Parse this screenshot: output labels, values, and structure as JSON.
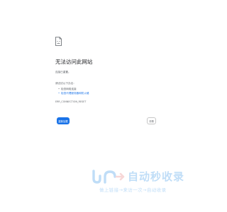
{
  "error_page": {
    "icon": "sad-document-icon",
    "title": "无法访问此网站",
    "subtitle": "连接已重置。",
    "try_label": "请试试以下办法：",
    "suggestions": [
      {
        "text": "检查网络连接",
        "is_link": false
      },
      {
        "text": "检查代理服务器和防火墙",
        "is_link": true
      }
    ],
    "error_code": "ERR_CONNECTION_RESET",
    "reload_label": "重新加载",
    "details_label": "详情"
  },
  "watermark": {
    "brand": "自动秒收录",
    "slogan": "做上链接→来访一次→自动收录"
  },
  "colors": {
    "accent": "#1a73e8",
    "text": "#202124",
    "muted": "#5f6368",
    "watermark": "#1e88e5"
  }
}
